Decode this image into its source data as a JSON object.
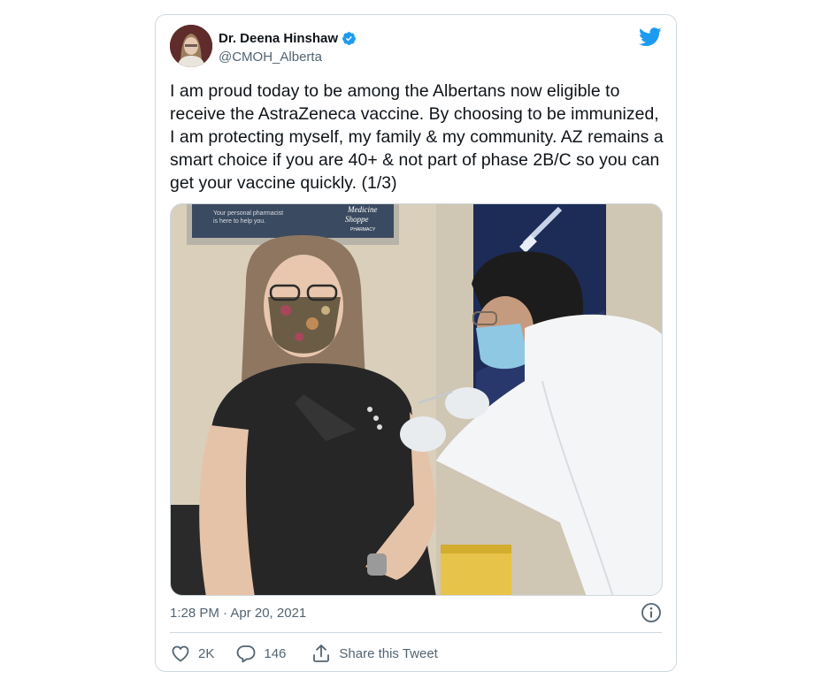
{
  "author": {
    "name": "Dr. Deena Hinshaw",
    "handle": "@CMOH_Alberta",
    "verified": true,
    "avatar_icon": "profile-photo"
  },
  "brand_icon": "twitter-bird-icon",
  "tweet": {
    "text": "I am proud today to be among the Albertans now eligible to receive the AstraZeneca vaccine. By choosing to be immunized, I am protecting myself, my family & my community. AZ remains a smart choice if you are 40+ & not part of phase 2B/C so you can get your vaccine quickly. (1/3)"
  },
  "photo": {
    "sign_line1": "Your personal pharmacist",
    "sign_line2": "is here to help you.",
    "sign_brand1": "Medicine",
    "sign_brand2": "Shoppe",
    "sign_brand3": "PHARMACY"
  },
  "meta": {
    "timestamp": "1:28 PM · Apr 20, 2021"
  },
  "actions": {
    "likes": "2K",
    "replies": "146",
    "share_label": "Share this Tweet"
  },
  "colors": {
    "brand_blue": "#1d9bf0",
    "text_primary": "#0f1419",
    "text_secondary": "#536471",
    "border": "#cfd9de"
  }
}
